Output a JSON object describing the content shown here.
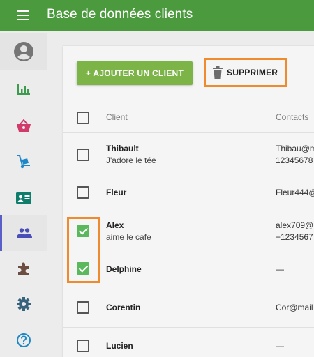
{
  "app": {
    "title": "Base de données clients"
  },
  "toolbar": {
    "add_label": "+ AJOUTER UN CLIENT",
    "delete_label": "SUPPRIMER"
  },
  "table": {
    "headers": {
      "client": "Client",
      "contacts": "Contacts"
    },
    "rows": [
      {
        "name": "Thibault",
        "note": "J'adore le tée",
        "contact1": "Thibau@m",
        "contact2": "12345678",
        "checked": false
      },
      {
        "name": "Fleur",
        "note": "",
        "contact1": "Fleur444@",
        "contact2": "",
        "checked": false
      },
      {
        "name": "Alex",
        "note": "aime le cafe",
        "contact1": "alex709@",
        "contact2": "+1234567",
        "checked": true
      },
      {
        "name": "Delphine",
        "note": "",
        "contact1": "—",
        "contact2": "",
        "checked": true
      },
      {
        "name": "Corentin",
        "note": "",
        "contact1": "Cor@mail",
        "contact2": "",
        "checked": false
      },
      {
        "name": "Lucien",
        "note": "",
        "contact1": "—",
        "contact2": "",
        "checked": false
      }
    ]
  },
  "sidebar": {
    "items": [
      {
        "icon": "account-circle-icon"
      },
      {
        "icon": "bar-chart-icon"
      },
      {
        "icon": "basket-icon"
      },
      {
        "icon": "hand-truck-icon"
      },
      {
        "icon": "contact-card-icon"
      },
      {
        "icon": "people-icon",
        "active": true
      },
      {
        "icon": "puzzle-icon"
      },
      {
        "icon": "gear-icon"
      },
      {
        "icon": "help-icon"
      }
    ]
  },
  "colors": {
    "topbar": "#4b9a3e",
    "add_button": "#7db448",
    "highlight": "#ef8b2d",
    "checkbox_checked": "#5cb85c",
    "active_nav": "#5a5fc7"
  }
}
